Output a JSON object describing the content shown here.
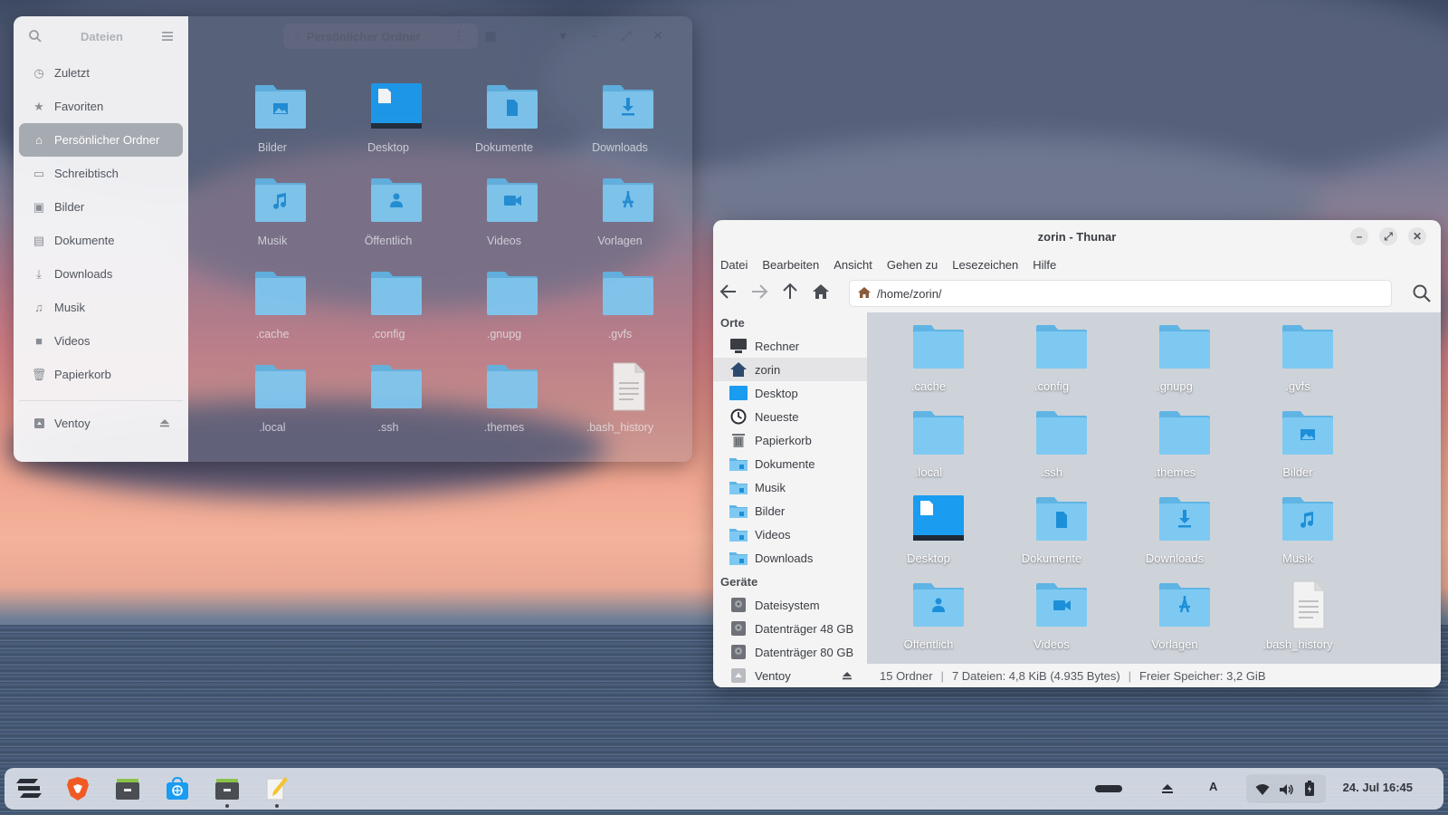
{
  "nautilus": {
    "title": "Dateien",
    "path_label": "Persönlicher Ordner",
    "sidebar": [
      {
        "label": "Zuletzt",
        "icon": "clock-icon"
      },
      {
        "label": "Favoriten",
        "icon": "star-icon"
      },
      {
        "label": "Persönlicher Ordner",
        "icon": "home-icon",
        "active": true
      },
      {
        "label": "Schreibtisch",
        "icon": "desktop-icon"
      },
      {
        "label": "Bilder",
        "icon": "image-icon"
      },
      {
        "label": "Dokumente",
        "icon": "document-icon"
      },
      {
        "label": "Downloads",
        "icon": "download-icon"
      },
      {
        "label": "Musik",
        "icon": "music-icon"
      },
      {
        "label": "Videos",
        "icon": "video-icon"
      },
      {
        "label": "Papierkorb",
        "icon": "trash-icon"
      }
    ],
    "device": {
      "label": "Ventoy",
      "icon": "drive-icon"
    },
    "items": [
      {
        "label": "Bilder",
        "type": "pictures"
      },
      {
        "label": "Desktop",
        "type": "desktop"
      },
      {
        "label": "Dokumente",
        "type": "documents"
      },
      {
        "label": "Downloads",
        "type": "downloads"
      },
      {
        "label": "Musik",
        "type": "music"
      },
      {
        "label": "Öffentlich",
        "type": "public"
      },
      {
        "label": "Videos",
        "type": "videos"
      },
      {
        "label": "Vorlagen",
        "type": "templates"
      },
      {
        "label": ".cache",
        "type": "folder"
      },
      {
        "label": ".config",
        "type": "folder"
      },
      {
        "label": ".gnupg",
        "type": "folder"
      },
      {
        "label": ".gvfs",
        "type": "folder"
      },
      {
        "label": ".local",
        "type": "folder"
      },
      {
        "label": ".ssh",
        "type": "folder"
      },
      {
        "label": ".themes",
        "type": "folder"
      },
      {
        "label": ".bash_history",
        "type": "file"
      }
    ]
  },
  "thunar": {
    "title": "zorin - Thunar",
    "menu": [
      "Datei",
      "Bearbeiten",
      "Ansicht",
      "Gehen zu",
      "Lesezeichen",
      "Hilfe"
    ],
    "address": "/home/zorin/",
    "places_header": "Orte",
    "places": [
      {
        "label": "Rechner",
        "icon": "computer-icon"
      },
      {
        "label": "zorin",
        "icon": "home-icon",
        "selected": true
      },
      {
        "label": "Desktop",
        "icon": "desktop-icon"
      },
      {
        "label": "Neueste",
        "icon": "clock-icon"
      },
      {
        "label": "Papierkorb",
        "icon": "trash-icon"
      },
      {
        "label": "Dokumente",
        "icon": "folder-documents-icon"
      },
      {
        "label": "Musik",
        "icon": "folder-music-icon"
      },
      {
        "label": "Bilder",
        "icon": "folder-pictures-icon"
      },
      {
        "label": "Videos",
        "icon": "folder-videos-icon"
      },
      {
        "label": "Downloads",
        "icon": "folder-downloads-icon"
      }
    ],
    "devices_header": "Geräte",
    "devices": [
      {
        "label": "Dateisystem",
        "icon": "harddisk-icon"
      },
      {
        "label": "Datenträger 48 GB",
        "icon": "harddisk-icon"
      },
      {
        "label": "Datenträger 80 GB",
        "icon": "harddisk-icon"
      },
      {
        "label": "Ventoy",
        "icon": "drive-icon"
      }
    ],
    "items": [
      {
        "label": ".cache",
        "type": "folder"
      },
      {
        "label": ".config",
        "type": "folder"
      },
      {
        "label": ".gnupg",
        "type": "folder"
      },
      {
        "label": ".gvfs",
        "type": "folder"
      },
      {
        "label": ".local",
        "type": "folder"
      },
      {
        "label": ".ssh",
        "type": "folder"
      },
      {
        "label": ".themes",
        "type": "folder"
      },
      {
        "label": "Bilder",
        "type": "pictures"
      },
      {
        "label": "Desktop",
        "type": "desktop"
      },
      {
        "label": "Dokumente",
        "type": "documents"
      },
      {
        "label": "Downloads",
        "type": "downloads"
      },
      {
        "label": "Musik",
        "type": "music"
      },
      {
        "label": "Öffentlich",
        "type": "public"
      },
      {
        "label": "Videos",
        "type": "videos"
      },
      {
        "label": "Vorlagen",
        "type": "templates"
      },
      {
        "label": ".bash_history",
        "type": "file"
      }
    ],
    "status": {
      "folders": "15 Ordner",
      "files": "7 Dateien: 4,8 KiB (4.935 Bytes)",
      "free": "Freier Speicher: 3,2 GiB"
    }
  },
  "taskbar": {
    "apps": [
      {
        "name": "zorin-menu-icon"
      },
      {
        "name": "brave-browser-icon"
      },
      {
        "name": "file-manager-icon"
      },
      {
        "name": "software-store-icon"
      },
      {
        "name": "file-manager-icon",
        "running": true
      },
      {
        "name": "text-editor-icon",
        "running": true
      }
    ],
    "keyboard_layout": "A",
    "clock": "24. Jul  16:45"
  },
  "colors": {
    "folder": "#7ec9f2",
    "folder_dark": "#5fb4e4",
    "folder_glyph": "#1d8fd8",
    "desktop_blue": "#1a9cf0",
    "accent_home": "#2c4a6e"
  }
}
